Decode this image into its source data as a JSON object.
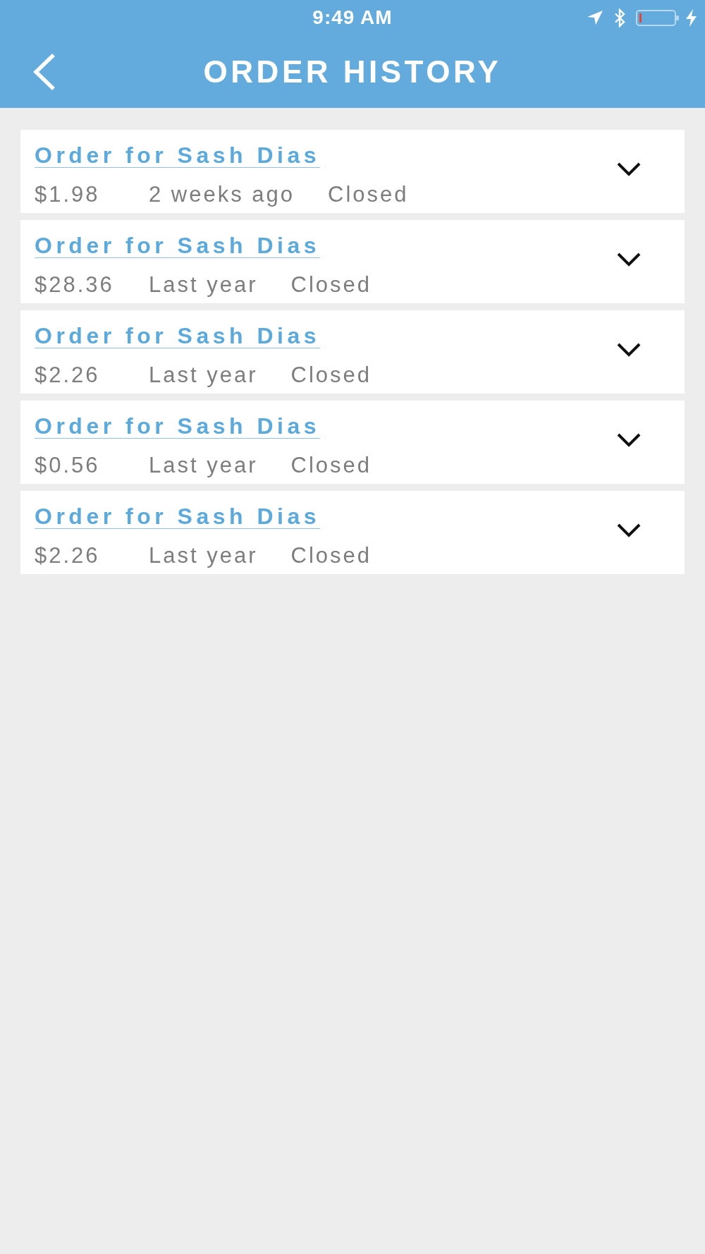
{
  "status_bar": {
    "time": "9:49 AM"
  },
  "header": {
    "title": "ORDER HISTORY"
  },
  "orders": [
    {
      "title": "Order for Sash Dias",
      "amount": "$1.98",
      "date": "2 weeks ago",
      "status": "Closed",
      "expanded": false
    },
    {
      "title": "Order for Sash Dias",
      "amount": "$28.36",
      "date": "Last year",
      "status": "Closed",
      "expanded": false
    },
    {
      "title": "Order for Sash Dias",
      "amount": "$2.26",
      "date": "Last year",
      "status": "Closed",
      "expanded": false
    },
    {
      "title": "Order for Sash Dias",
      "amount": "$0.56",
      "date": "Last year",
      "status": "Closed",
      "expanded": false
    },
    {
      "title": "Order for Sash Dias",
      "amount": "$2.26",
      "date": "Last year",
      "status": "Closed",
      "expanded": false
    }
  ]
}
